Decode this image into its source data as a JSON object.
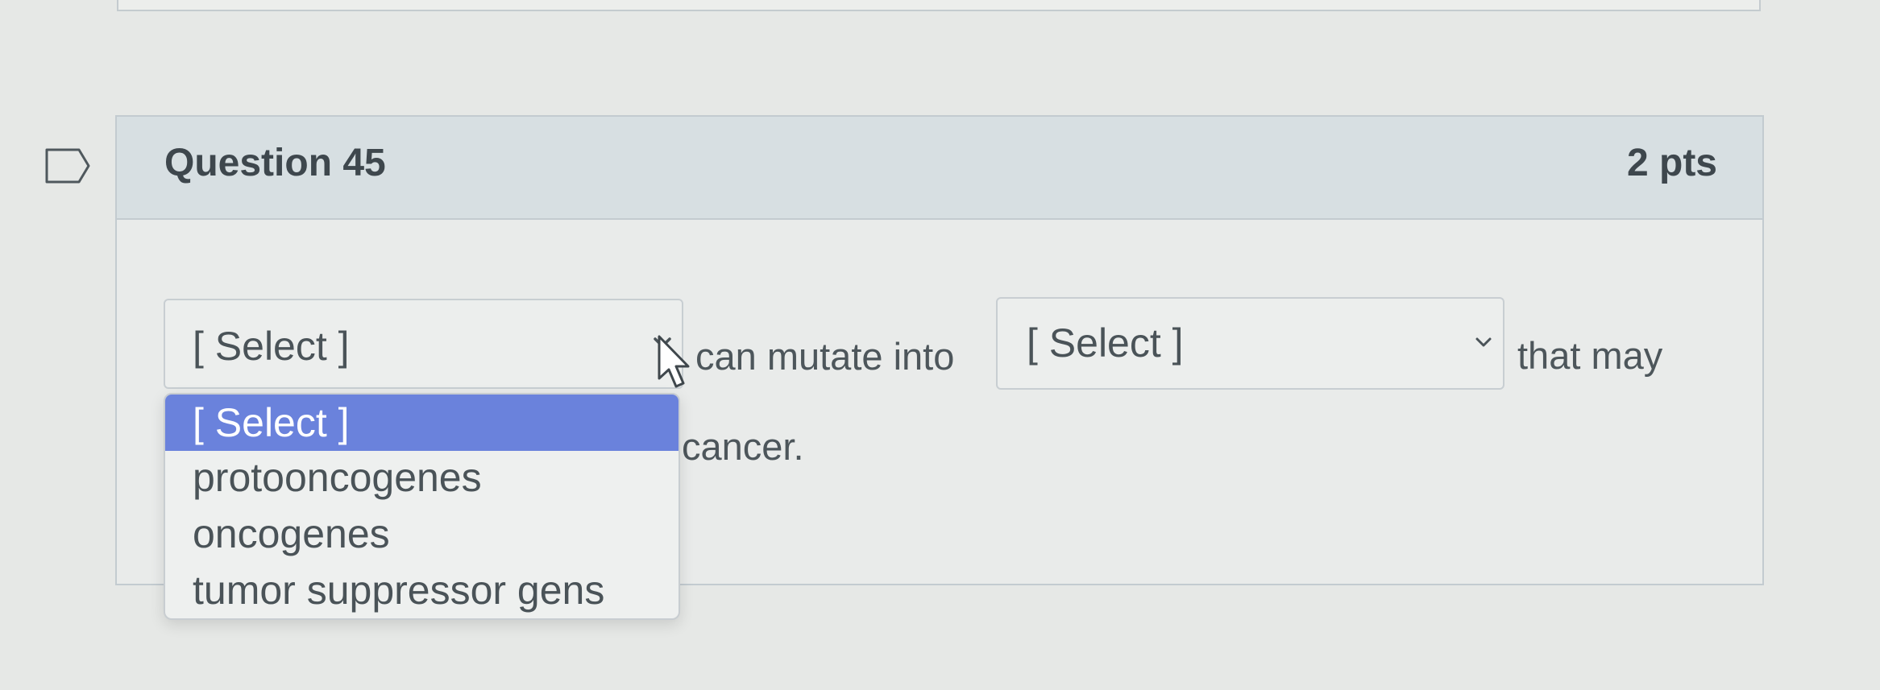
{
  "question": {
    "title": "Question 45",
    "points": "2 pts"
  },
  "sentence": {
    "select1": {
      "value": "[ Select ]",
      "options": [
        "[ Select ]",
        "protooncogenes",
        "oncogenes",
        "tumor suppressor gens"
      ],
      "highlighted_index": 0
    },
    "text1": "can mutate into",
    "select2": {
      "value": "[ Select ]"
    },
    "text2": "that may",
    "text3": "cancer."
  },
  "colors": {
    "highlight": "#6a82dc",
    "header_bg": "#d7dfe2",
    "border": "#c3cbd0"
  },
  "icons": {
    "flag": "flag-outline-icon",
    "select_arrow": "chevron-down-icon",
    "cursor": "mouse-pointer-icon"
  }
}
